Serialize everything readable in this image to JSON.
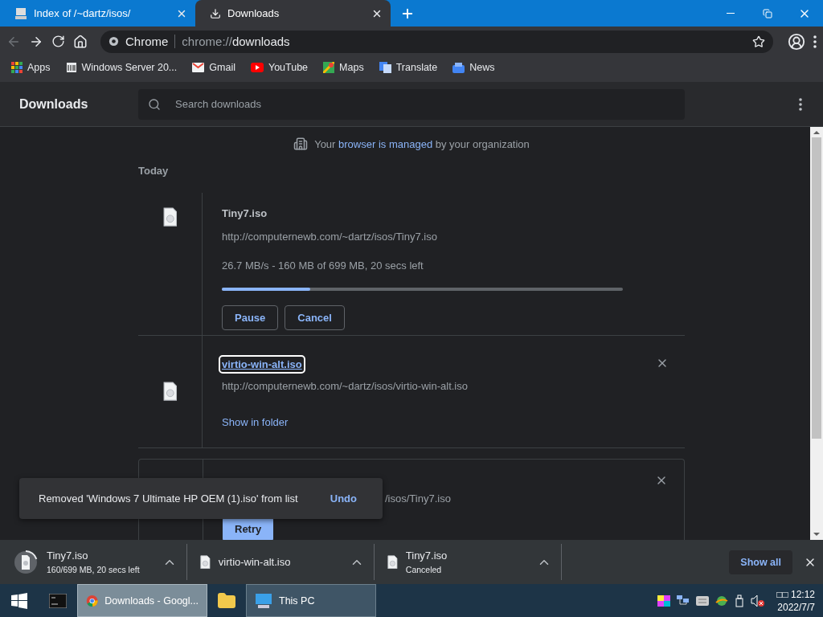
{
  "tabs": [
    {
      "title": "Index of /~dartz/isos/",
      "selected": false
    },
    {
      "title": "Downloads",
      "selected": true
    }
  ],
  "toolbar": {
    "chip": "Chrome",
    "url_scheme": "chrome://",
    "url_path": "downloads"
  },
  "bookmarks": [
    {
      "kind": "apps",
      "label": "Apps"
    },
    {
      "kind": "site",
      "label": "Windows Server 20..."
    },
    {
      "kind": "mail",
      "label": "Gmail"
    },
    {
      "kind": "video",
      "label": "YouTube"
    },
    {
      "kind": "map",
      "label": "Maps"
    },
    {
      "kind": "translate",
      "label": "Translate"
    },
    {
      "kind": "news",
      "label": "News"
    }
  ],
  "page": {
    "title": "Downloads",
    "search_placeholder": "Search downloads",
    "notice_before": "Your",
    "notice_link": "browser is managed",
    "notice_after": "by your organization",
    "date_header": "Today"
  },
  "downloads": [
    {
      "kind": "in_progress",
      "name": "Tiny7.iso",
      "url": "http://computernewb.com/~dartz/isos/Tiny7.iso",
      "status": "26.7 MB/s - 160 MB of 699 MB, 20 secs left",
      "level": 0.22,
      "buttons": [
        "Pause",
        "Cancel"
      ]
    },
    {
      "kind": "complete",
      "name": "virtio-win-alt.iso",
      "focused": true,
      "url": "http://computernewb.com/~dartz/isos/virtio-win-alt.iso",
      "link": "Show in folder"
    },
    {
      "kind": "canceled",
      "url": "/isos/Tiny7.iso",
      "buttons": [
        "Retry"
      ]
    }
  ],
  "toast": {
    "message": "Removed 'Windows 7 Ultimate HP OEM (1).iso' from list",
    "action": "Undo"
  },
  "shelf": {
    "items": [
      {
        "kind": "in_progress",
        "name": "Tiny7.iso",
        "status": "160/699 MB, 20 secs left"
      },
      {
        "kind": "complete",
        "name": "virtio-win-alt.iso"
      },
      {
        "kind": "canceled",
        "name": "Tiny7.iso",
        "status": "Canceled"
      }
    ],
    "show_all": "Show all"
  },
  "taskbar": {
    "apps": [
      {
        "kind": "terminal"
      },
      {
        "kind": "chrome",
        "label": "Downloads - Googl...",
        "selected": true
      },
      {
        "kind": "explorer"
      },
      {
        "kind": "pc",
        "label": "This PC",
        "selected": false
      }
    ],
    "time": "□□ 12:12",
    "date": "2022/7/7"
  }
}
